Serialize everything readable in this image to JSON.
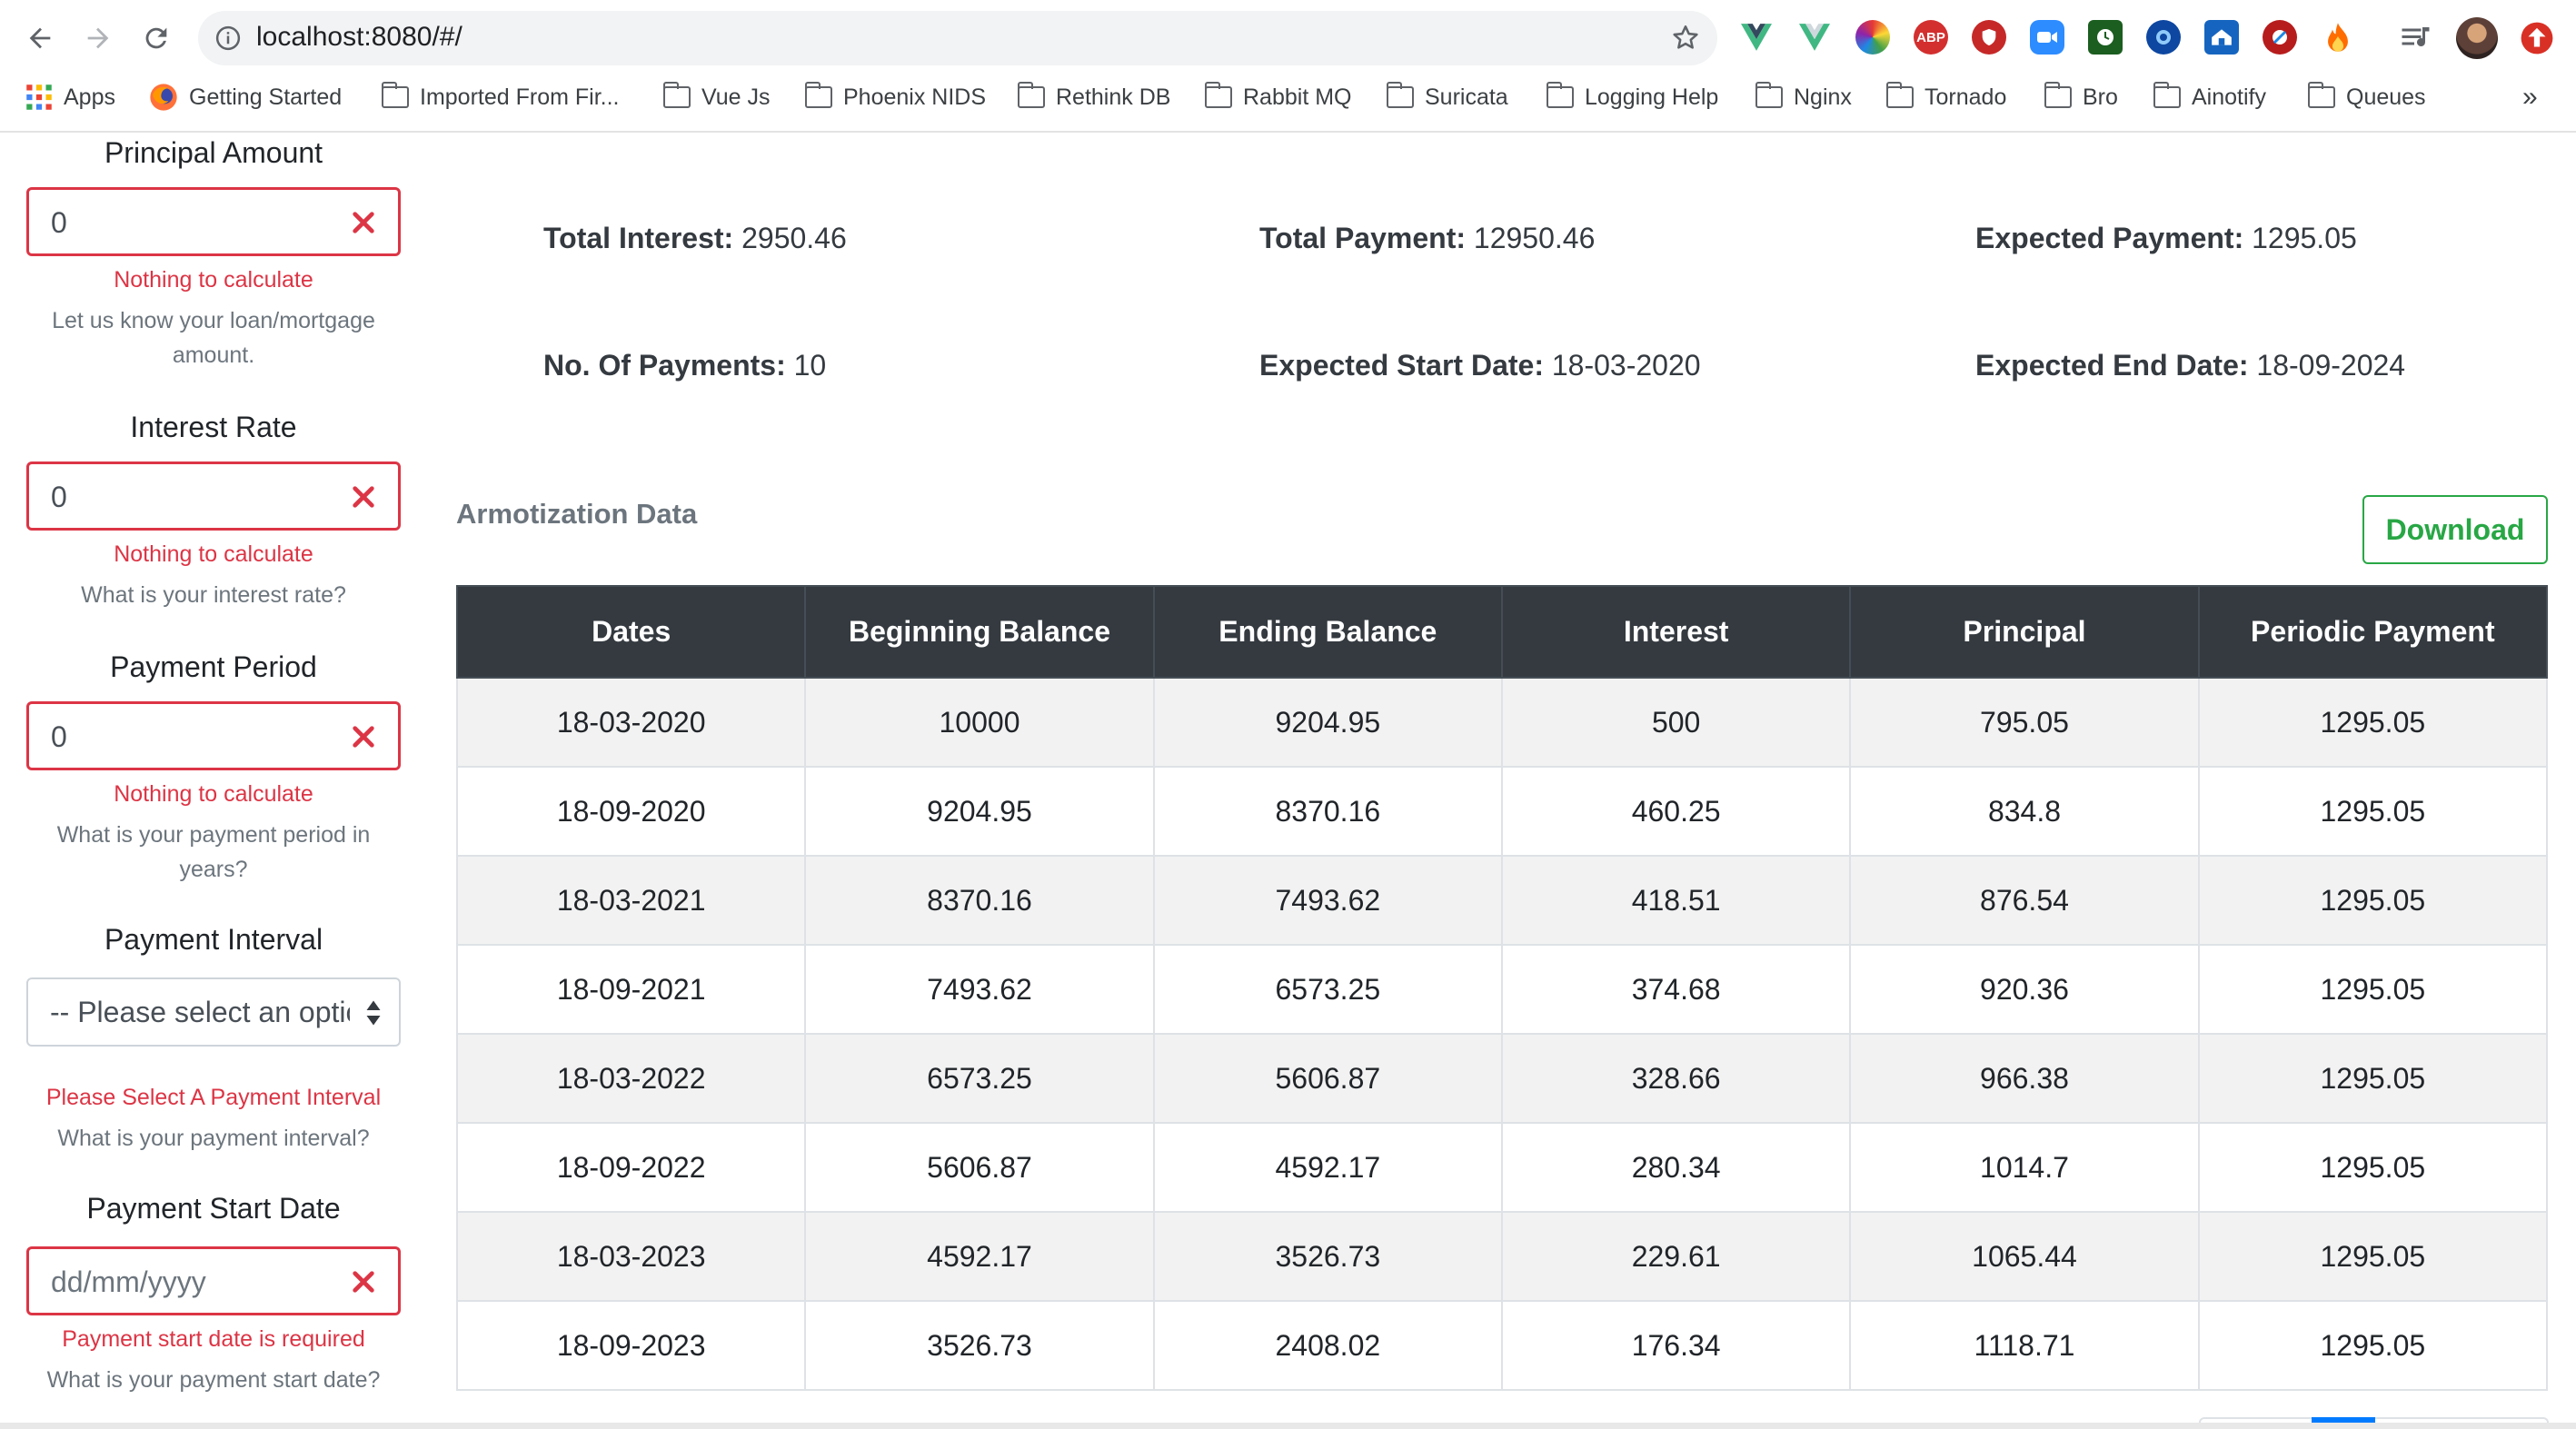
{
  "browser": {
    "url": "localhost:8080/#/",
    "bookmarks": [
      "Apps",
      "Getting Started",
      "Imported From Fir...",
      "Vue Js",
      "Phoenix NIDS",
      "Rethink DB",
      "Rabbit MQ",
      "Suricata",
      "Logging Help",
      "Nginx",
      "Tornado",
      "Bro",
      "Ainotify",
      "Queues"
    ],
    "overflow": "»",
    "extensions": [
      "vue-devtools-icon",
      "vue-devtools-icon",
      "color-picker-icon",
      "adblock-plus-icon",
      "ublock-icon",
      "zoom-icon",
      "clock-icon",
      "extension-icon",
      "extension-icon",
      "extension-icon",
      "fire-icon"
    ],
    "adblock_label": "ABP"
  },
  "form": {
    "principal": {
      "label": "Principal Amount",
      "value": "0",
      "error": "Nothing to calculate",
      "hint": "Let us know your loan/mortgage amount."
    },
    "rate": {
      "label": "Interest Rate",
      "value": "0",
      "error": "Nothing to calculate",
      "hint": "What is your interest rate?"
    },
    "period": {
      "label": "Payment Period",
      "value": "0",
      "error": "Nothing to calculate",
      "hint": "What is your payment period in years?"
    },
    "interval": {
      "label": "Payment Interval",
      "selected": "-- Please select an option --",
      "error": "Please Select A Payment Interval",
      "hint": "What is your payment interval?"
    },
    "start_date": {
      "label": "Payment Start Date",
      "placeholder": "dd/mm/yyyy",
      "error": "Payment start date is required",
      "hint": "What is your payment start date?"
    }
  },
  "summary": {
    "total_interest": {
      "label": "Total Interest:",
      "value": "2950.46"
    },
    "total_payment": {
      "label": "Total Payment:",
      "value": "12950.46"
    },
    "expected_payment": {
      "label": "Expected Payment:",
      "value": "1295.05"
    },
    "num_payments": {
      "label": "No. Of Payments:",
      "value": "10"
    },
    "start_date": {
      "label": "Expected Start Date:",
      "value": "18-03-2020"
    },
    "end_date": {
      "label": "Expected End Date:",
      "value": "18-09-2024"
    }
  },
  "amortization": {
    "title": "Armotization Data",
    "download_label": "Download",
    "columns": [
      "Dates",
      "Beginning Balance",
      "Ending Balance",
      "Interest",
      "Principal",
      "Periodic Payment"
    ],
    "rows": [
      [
        "18-03-2020",
        "10000",
        "9204.95",
        "500",
        "795.05",
        "1295.05"
      ],
      [
        "18-09-2020",
        "9204.95",
        "8370.16",
        "460.25",
        "834.8",
        "1295.05"
      ],
      [
        "18-03-2021",
        "8370.16",
        "7493.62",
        "418.51",
        "876.54",
        "1295.05"
      ],
      [
        "18-09-2021",
        "7493.62",
        "6573.25",
        "374.68",
        "920.36",
        "1295.05"
      ],
      [
        "18-03-2022",
        "6573.25",
        "5606.87",
        "328.66",
        "966.38",
        "1295.05"
      ],
      [
        "18-09-2022",
        "5606.87",
        "4592.17",
        "280.34",
        "1014.7",
        "1295.05"
      ],
      [
        "18-03-2023",
        "4592.17",
        "3526.73",
        "229.61",
        "1065.44",
        "1295.05"
      ],
      [
        "18-09-2023",
        "3526.73",
        "2408.02",
        "176.34",
        "1118.71",
        "1295.05"
      ]
    ]
  },
  "colors": {
    "error": "#dc3545",
    "success": "#28a745",
    "table_header": "#343a40",
    "stripe": "#f2f2f2",
    "pager_active": "#007bff"
  }
}
